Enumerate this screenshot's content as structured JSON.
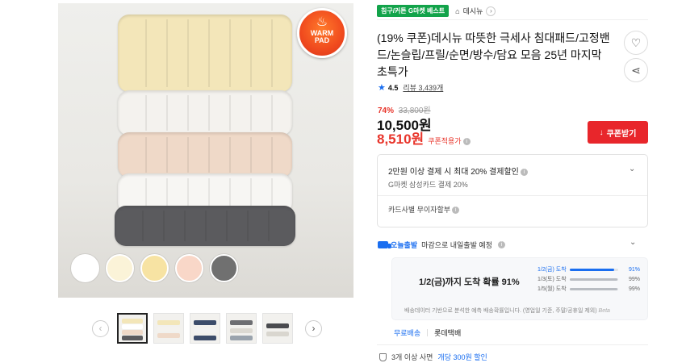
{
  "product_image": {
    "badge": {
      "line1": "WARM",
      "line2": "PAD",
      "icon": "flame-icon"
    },
    "swatches": [
      "#ffffff",
      "#fbf3d8",
      "#f7e3a3",
      "#f9d7c8",
      "#707070"
    ]
  },
  "thumbnails": {
    "count": 6,
    "active_index": 0,
    "prev_icon": "chevron-left-icon",
    "next_icon": "chevron-right-icon"
  },
  "tags": {
    "best": "침구/커튼 G마켓 베스트",
    "store": "데시뉴"
  },
  "title": "(19% 쿠폰)데시뉴 따뜻한 극세사 침대패드/고정밴드/논슬립/프릴/순면/방수/담요 모음 25년 마지막 초특가",
  "rating": {
    "score": "4.5",
    "reviews_label": "리뷰 3,439개"
  },
  "pricing": {
    "discount_pct": "74%",
    "original_price": "33,800원",
    "price": "10,500원",
    "coupon_price": "8,510원",
    "coupon_note": "쿠폰적용가",
    "coupon_button": "쿠폰받기"
  },
  "card_benefit": {
    "main": "2만원 이상 결제 시 최대 20% 결제할인",
    "sub": "G마켓 삼성카드 결제 20%",
    "installment": "카드사별 무이자할부"
  },
  "delivery": {
    "badge": "오늘출발",
    "text": "마감으로 내일출발 예정",
    "headline": "1/2(금)까지 도착 확률 91%",
    "forecast": [
      {
        "label": "1/2(금) 도착",
        "percent": "91%",
        "value": 0.91
      },
      {
        "label": "1/3(토) 도착",
        "percent": "99%",
        "value": 0.99
      },
      {
        "label": "1/5(월) 도착",
        "percent": "99%",
        "value": 0.99
      }
    ],
    "disclaimer": "배송데이터 기반으로 분석한 예측 배송확률입니다. (영업일 기준, 주말/공휴일 제외)",
    "beta": "Beta"
  },
  "shipping": {
    "fee": "무료배송",
    "carrier": "롯데택배"
  },
  "bundle": {
    "prefix": "3개 이상 사면",
    "highlight": "개당 300원 할인"
  }
}
